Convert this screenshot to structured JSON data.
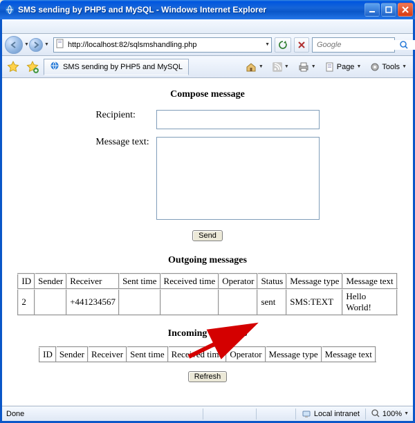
{
  "window": {
    "title": "SMS sending by PHP5 and MySQL - Windows Internet Explorer"
  },
  "address": {
    "url": "http://localhost:82/sqlsmshandling.php"
  },
  "search": {
    "placeholder": "Google"
  },
  "tab": {
    "title": "SMS sending by PHP5 and MySQL"
  },
  "toolbar": {
    "page": "Page",
    "tools": "Tools"
  },
  "page": {
    "compose_heading": "Compose message",
    "recipient_label": "Recipient:",
    "message_label": "Message text:",
    "send_label": "Send",
    "outgoing_heading": "Outgoing messages",
    "incoming_heading": "Incoming messages",
    "refresh_label": "Refresh",
    "columns": {
      "id": "ID",
      "sender": "Sender",
      "receiver": "Receiver",
      "sent_time": "Sent time",
      "received_time": "Received time",
      "operator": "Operator",
      "status": "Status",
      "msg_type": "Message type",
      "msg_text": "Message text"
    },
    "outgoing_rows": [
      {
        "id": "2",
        "sender": "",
        "receiver": "+441234567",
        "sent_time": "",
        "received_time": "",
        "operator": "",
        "status": "sent",
        "msg_type": "SMS:TEXT",
        "msg_text": "Hello World!"
      }
    ]
  },
  "status": {
    "left": "Done",
    "zone": "Local intranet",
    "zoom": "100%"
  }
}
